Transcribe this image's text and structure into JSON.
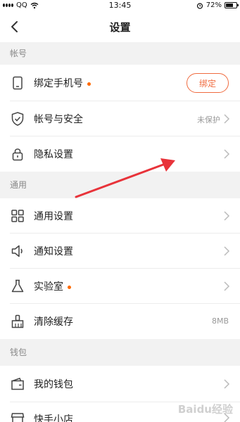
{
  "status_bar": {
    "carrier": "QQ",
    "time": "13:45",
    "battery": "72%"
  },
  "nav": {
    "title": "设置"
  },
  "sections": [
    {
      "header": "帐号",
      "rows": [
        {
          "label": "绑定手机号",
          "dot": true,
          "button": "绑定",
          "icon": "phone-icon"
        },
        {
          "label": "帐号与安全",
          "value": "未保护",
          "icon": "shield-icon"
        },
        {
          "label": "隐私设置",
          "icon": "lock-icon"
        }
      ]
    },
    {
      "header": "通用",
      "rows": [
        {
          "label": "通用设置",
          "icon": "grid-icon"
        },
        {
          "label": "通知设置",
          "icon": "speaker-icon"
        },
        {
          "label": "实验室",
          "dot": true,
          "icon": "flask-icon"
        },
        {
          "label": "清除缓存",
          "value": "8MB",
          "icon": "broom-icon"
        }
      ]
    },
    {
      "header": "钱包",
      "rows": [
        {
          "label": "我的钱包",
          "icon": "wallet-icon"
        },
        {
          "label": "快手小店",
          "icon": "shop-icon"
        }
      ]
    }
  ],
  "watermark": "Baidu经验",
  "colors": {
    "accent": "#f06b3f",
    "arrow": "#e8333a"
  }
}
